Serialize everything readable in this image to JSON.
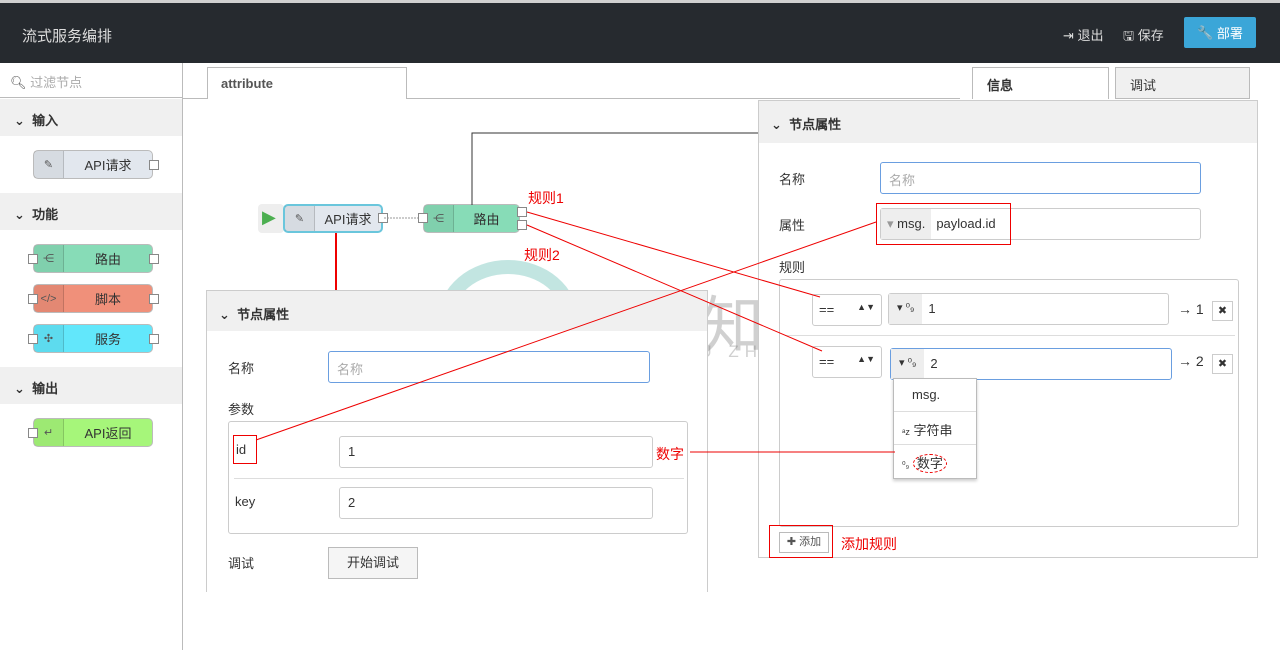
{
  "header": {
    "title": "流式服务编排",
    "logout": "退出",
    "save": "保存",
    "deploy": "部署"
  },
  "sidebar": {
    "filter_placeholder": "过滤节点",
    "categories": [
      {
        "label": "输入",
        "nodes": [
          {
            "label": "API请求",
            "color": "#e2e7ee"
          }
        ]
      },
      {
        "label": "功能",
        "nodes": [
          {
            "label": "路由",
            "color": "#87dcb7"
          },
          {
            "label": "脚本",
            "color": "#f0907a"
          },
          {
            "label": "服务",
            "color": "#62e7fb"
          }
        ]
      },
      {
        "label": "输出",
        "nodes": [
          {
            "label": "API返回",
            "color": "#a6f67a"
          }
        ]
      }
    ]
  },
  "workspace": {
    "tab": "attribute",
    "flow_nodes": [
      {
        "label": "API请求"
      },
      {
        "label": "路由"
      }
    ]
  },
  "right_tabs": [
    "信息",
    "调试"
  ],
  "right_panel": {
    "title": "节点属性",
    "name_label": "名称",
    "name_placeholder": "名称",
    "property_label": "属性",
    "property_prefix": "msg.",
    "property_value": "payload.id",
    "rules_label": "规则",
    "rules": [
      {
        "op": "==",
        "type": "0-9",
        "value": "1",
        "output": "→ 1"
      },
      {
        "op": "==",
        "type": "0-9",
        "value": "2",
        "output": "→ 2"
      }
    ],
    "dropdown": [
      "msg.",
      "字符串",
      "数字"
    ],
    "add_button": "添加"
  },
  "left_panel": {
    "title": "节点属性",
    "name_label": "名称",
    "name_placeholder": "名称",
    "params_label": "参数",
    "params": [
      {
        "key": "id",
        "value": "1"
      },
      {
        "key": "key",
        "value": "2"
      }
    ],
    "debug_label": "调试",
    "debug_button": "开始调试"
  },
  "annotations": {
    "rule1": "规则1",
    "rule2": "规则2",
    "number": "数字",
    "add_rule": "添加规则"
  },
  "watermark": {
    "cn": "小牛知识库",
    "en": "XIAO NIU ZHI SHI KU"
  }
}
